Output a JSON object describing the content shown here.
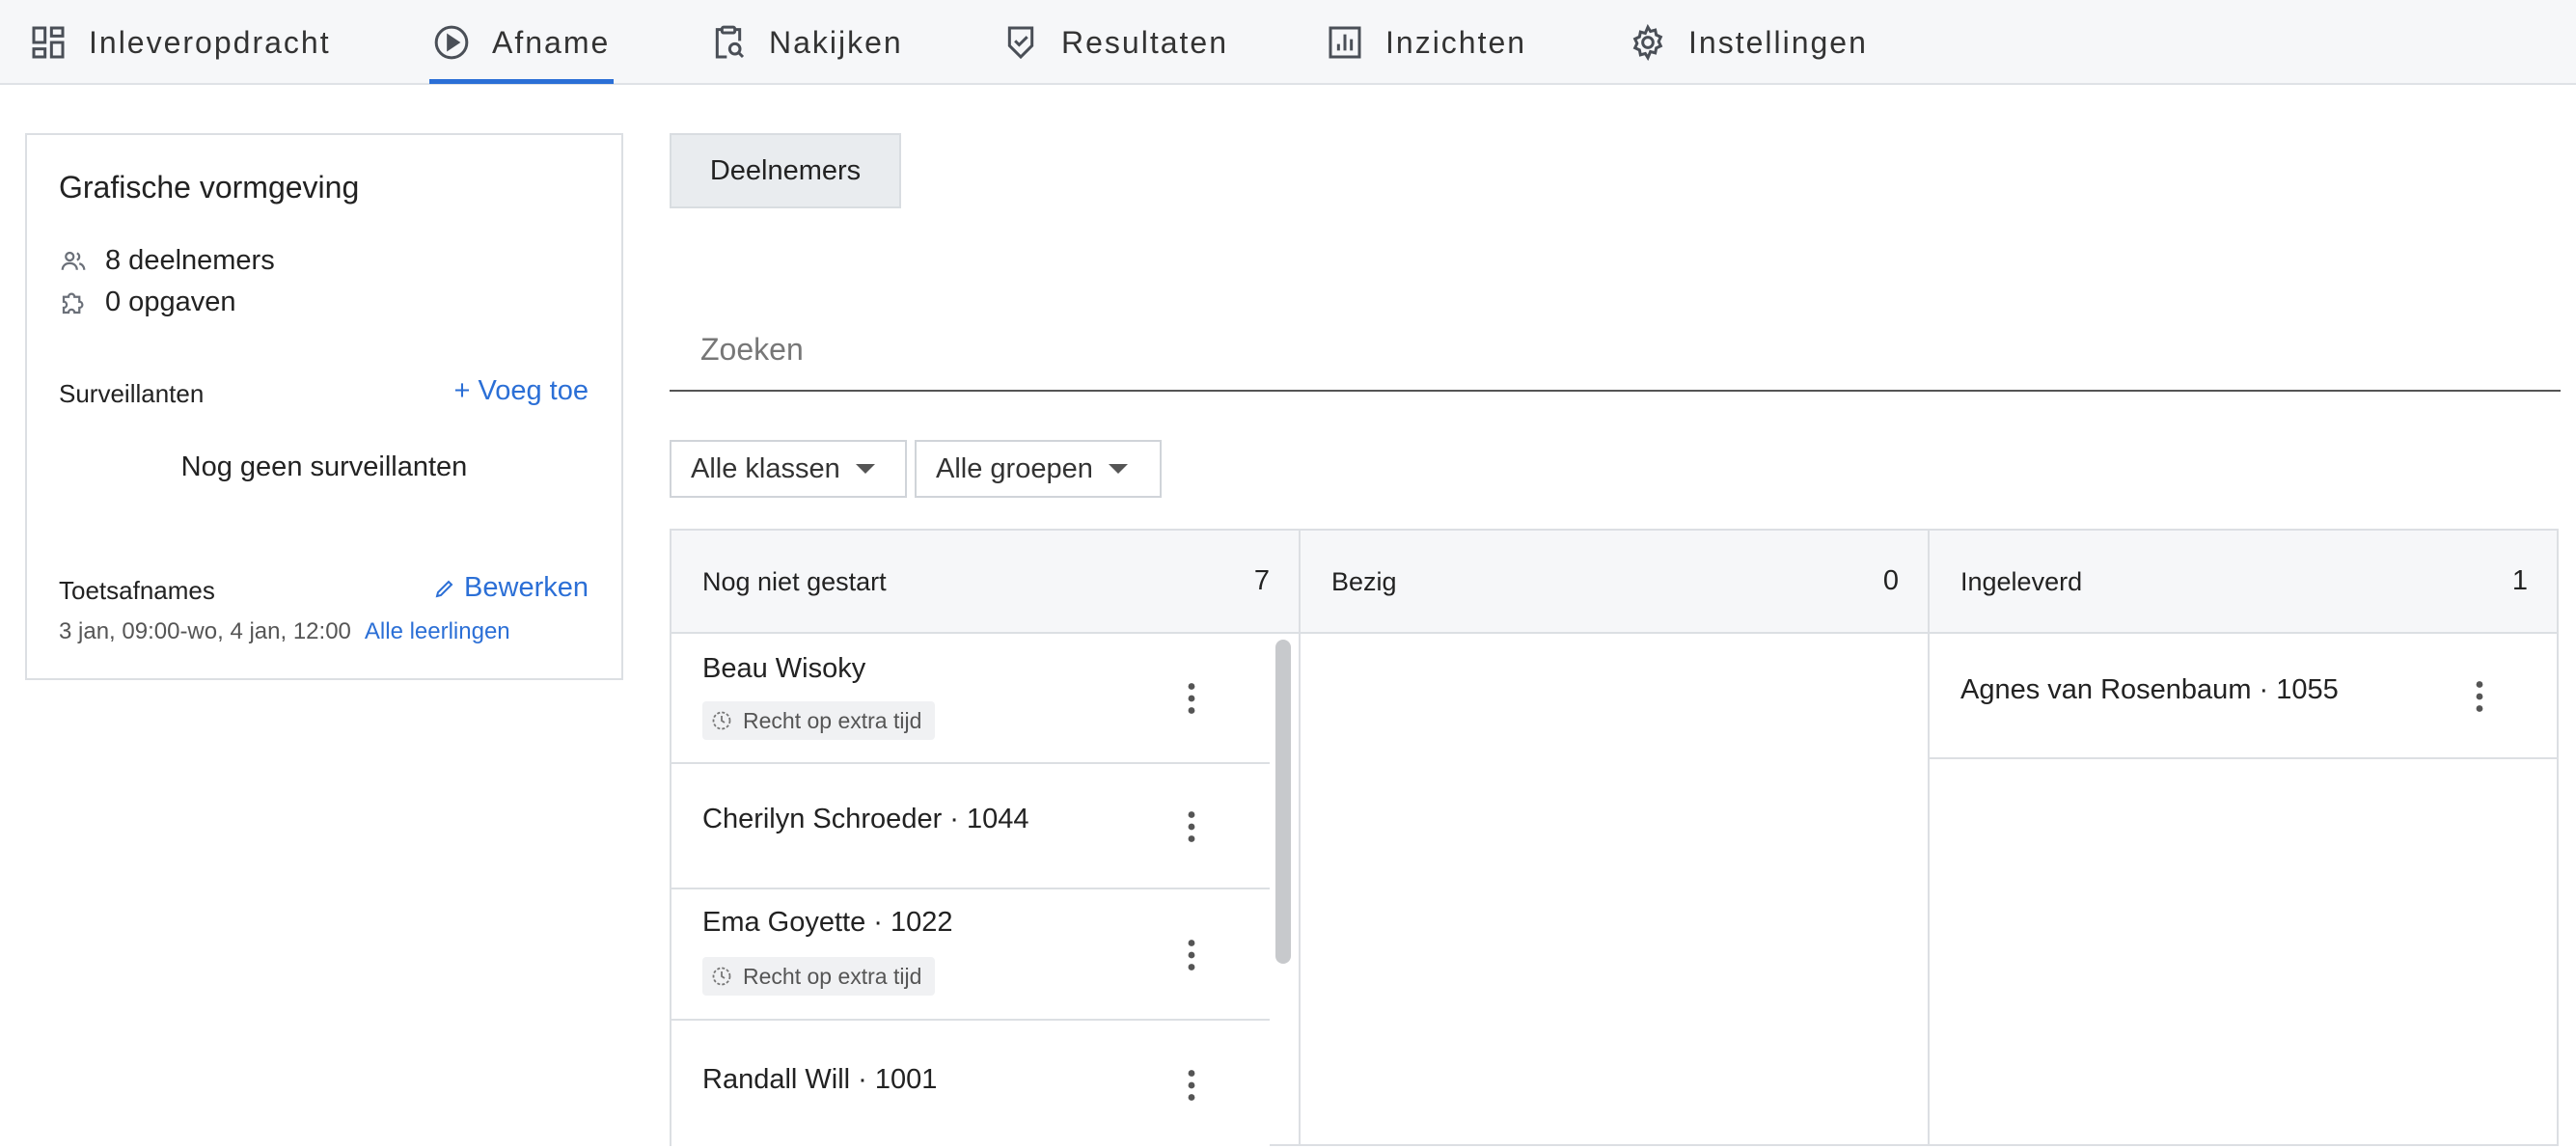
{
  "nav": {
    "tabs": [
      {
        "label": "Inleveropdracht",
        "icon": "dashboard-grid-icon"
      },
      {
        "label": "Afname",
        "icon": "play-circle-icon",
        "active": true
      },
      {
        "label": "Nakijken",
        "icon": "clipboard-search-icon"
      },
      {
        "label": "Resultaten",
        "icon": "shield-check-icon"
      },
      {
        "label": "Inzichten",
        "icon": "bar-chart-icon"
      },
      {
        "label": "Instellingen",
        "icon": "gear-icon"
      }
    ],
    "accent": "#2b6fd6"
  },
  "card": {
    "title": "Grafische vormgeving",
    "participants": "8 deelnemers",
    "tasks": "0 opgaven",
    "supervisors_label": "Surveillanten",
    "add_label": "+ Voeg toe",
    "no_supervisors": "Nog geen surveillanten",
    "sessions_label": "Toetsafnames",
    "edit_label": "Bewerken",
    "session_time": "3 jan, 09:00-wo, 4 jan, 12:00",
    "session_scope": "Alle leerlingen"
  },
  "main": {
    "segment_label": "Deelnemers",
    "search_placeholder": "Zoeken",
    "filter_classes": "Alle klassen",
    "filter_groups": "Alle groepen"
  },
  "columns": [
    {
      "title": "Nog niet gestart",
      "count": "7",
      "students": [
        {
          "name": "Beau Wisoky",
          "badge": "Recht op extra tijd"
        },
        {
          "name": "Cherilyn Schroeder · 1044"
        },
        {
          "name": "Ema Goyette · 1022",
          "badge": "Recht op extra tijd"
        },
        {
          "name": "Randall Will · 1001"
        }
      ]
    },
    {
      "title": "Bezig",
      "count": "0",
      "students": []
    },
    {
      "title": "Ingeleverd",
      "count": "1",
      "students": [
        {
          "name": "Agnes van Rosenbaum · 1055"
        }
      ]
    }
  ]
}
